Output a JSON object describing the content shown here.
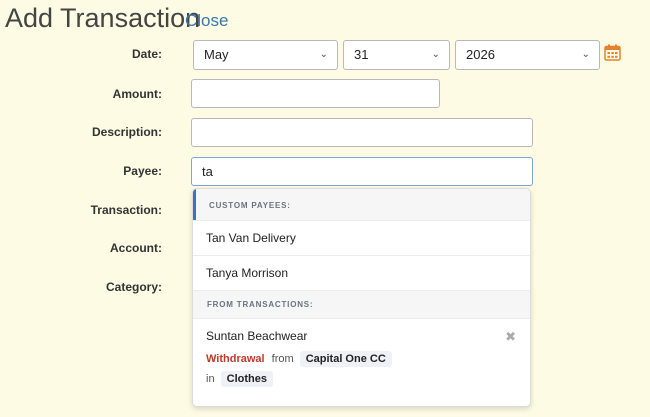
{
  "header": {
    "title": "Add Transaction",
    "close_label": "Close"
  },
  "form": {
    "date_label": "Date:",
    "month": "May",
    "day": "31",
    "year": "2026",
    "amount_label": "Amount:",
    "amount_value": "",
    "description_label": "Description:",
    "description_value": "",
    "payee_label": "Payee:",
    "payee_value": "ta",
    "transaction_label": "Transaction:",
    "account_label": "Account:",
    "category_label": "Category:"
  },
  "payee_dropdown": {
    "custom_header": "CUSTOM PAYEES:",
    "custom_payees": [
      "Tan Van Delivery",
      "Tanya Morrison"
    ],
    "transactions_header": "FROM TRANSACTIONS:",
    "transaction_match": {
      "payee": "Suntan Beachwear",
      "type": "Withdrawal",
      "from_word": "from",
      "account": "Capital One CC",
      "in_word": "in",
      "category": "Clothes"
    }
  },
  "colors": {
    "background": "#fdfbe4",
    "link": "#3a76b0",
    "withdrawal": "#c0392b",
    "calendar_icon": "#e8822a",
    "focus_accent": "#3a70c8"
  }
}
